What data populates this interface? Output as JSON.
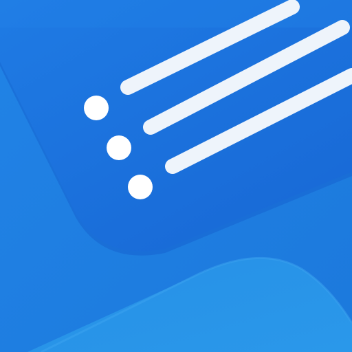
{
  "icon": {
    "name": "checklist-app-icon",
    "colors": {
      "background": "#1f7fe0",
      "upper_panel": "#1b72dd",
      "upper_panel_edge": "#1565cf",
      "lower_panel": "#2b95e8",
      "lower_panel_edge": "#3aa3ee",
      "lines": "#eef4fb",
      "dots": "#ffffff"
    },
    "list_rows": [
      {
        "name": "row-1"
      },
      {
        "name": "row-2"
      },
      {
        "name": "row-3"
      }
    ]
  }
}
